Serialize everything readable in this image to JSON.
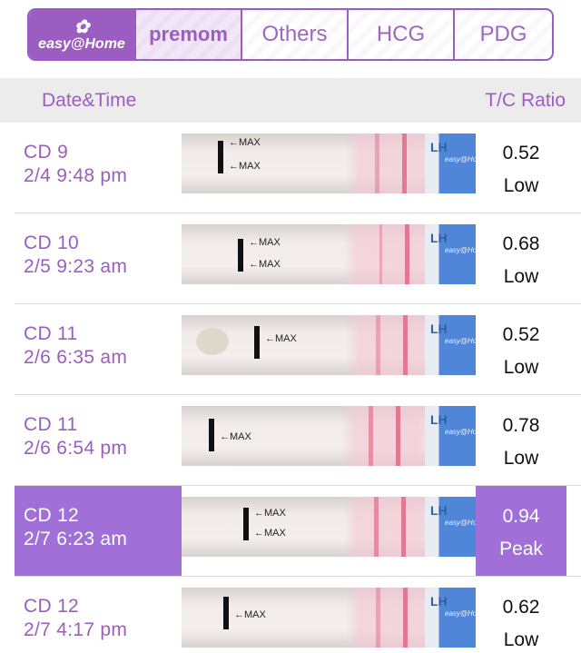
{
  "brand_tabs": [
    {
      "label": "easy@Home",
      "selected": true
    },
    {
      "label": "premom",
      "selected": false
    },
    {
      "label": "Others",
      "selected": false
    },
    {
      "label": "HCG",
      "selected": false
    },
    {
      "label": "PDG",
      "selected": false
    }
  ],
  "header": {
    "date_label": "Date&Time",
    "ratio_label": "T/C Ratio"
  },
  "strip": {
    "max_label": "←MAX",
    "lh_label": "LH",
    "brand_mark": "easy@Home"
  },
  "rows": [
    {
      "cd": "CD 9",
      "datetime": "2/4 9:48 pm",
      "ratio": "0.52",
      "level": "Low"
    },
    {
      "cd": "CD 10",
      "datetime": "2/5 9:23 am",
      "ratio": "0.68",
      "level": "Low"
    },
    {
      "cd": "CD 11",
      "datetime": "2/6 6:35 am",
      "ratio": "0.52",
      "level": "Low"
    },
    {
      "cd": "CD 11",
      "datetime": "2/6 6:54 pm",
      "ratio": "0.78",
      "level": "Low"
    },
    {
      "cd": "CD 12",
      "datetime": "2/7 6:23 am",
      "ratio": "0.94",
      "level": "Peak"
    },
    {
      "cd": "CD 12",
      "datetime": "2/7 4:17 pm",
      "ratio": "0.62",
      "level": "Low"
    }
  ],
  "colors": {
    "accent": "#9b5ec0",
    "peak_highlight": "#a16fd8",
    "header_bg": "#ececec"
  }
}
